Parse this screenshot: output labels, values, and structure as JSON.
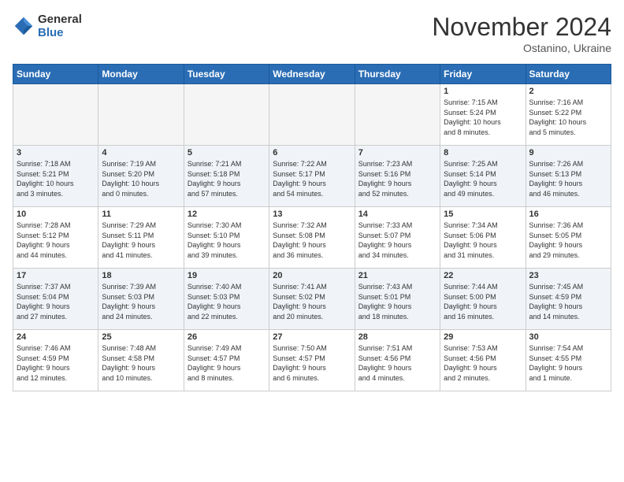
{
  "logo": {
    "line1": "General",
    "line2": "Blue"
  },
  "title": "November 2024",
  "location": "Ostanino, Ukraine",
  "days_of_week": [
    "Sunday",
    "Monday",
    "Tuesday",
    "Wednesday",
    "Thursday",
    "Friday",
    "Saturday"
  ],
  "weeks": [
    [
      {
        "day": "",
        "info": ""
      },
      {
        "day": "",
        "info": ""
      },
      {
        "day": "",
        "info": ""
      },
      {
        "day": "",
        "info": ""
      },
      {
        "day": "",
        "info": ""
      },
      {
        "day": "1",
        "info": "Sunrise: 7:15 AM\nSunset: 5:24 PM\nDaylight: 10 hours\nand 8 minutes."
      },
      {
        "day": "2",
        "info": "Sunrise: 7:16 AM\nSunset: 5:22 PM\nDaylight: 10 hours\nand 5 minutes."
      }
    ],
    [
      {
        "day": "3",
        "info": "Sunrise: 7:18 AM\nSunset: 5:21 PM\nDaylight: 10 hours\nand 3 minutes."
      },
      {
        "day": "4",
        "info": "Sunrise: 7:19 AM\nSunset: 5:20 PM\nDaylight: 10 hours\nand 0 minutes."
      },
      {
        "day": "5",
        "info": "Sunrise: 7:21 AM\nSunset: 5:18 PM\nDaylight: 9 hours\nand 57 minutes."
      },
      {
        "day": "6",
        "info": "Sunrise: 7:22 AM\nSunset: 5:17 PM\nDaylight: 9 hours\nand 54 minutes."
      },
      {
        "day": "7",
        "info": "Sunrise: 7:23 AM\nSunset: 5:16 PM\nDaylight: 9 hours\nand 52 minutes."
      },
      {
        "day": "8",
        "info": "Sunrise: 7:25 AM\nSunset: 5:14 PM\nDaylight: 9 hours\nand 49 minutes."
      },
      {
        "day": "9",
        "info": "Sunrise: 7:26 AM\nSunset: 5:13 PM\nDaylight: 9 hours\nand 46 minutes."
      }
    ],
    [
      {
        "day": "10",
        "info": "Sunrise: 7:28 AM\nSunset: 5:12 PM\nDaylight: 9 hours\nand 44 minutes."
      },
      {
        "day": "11",
        "info": "Sunrise: 7:29 AM\nSunset: 5:11 PM\nDaylight: 9 hours\nand 41 minutes."
      },
      {
        "day": "12",
        "info": "Sunrise: 7:30 AM\nSunset: 5:10 PM\nDaylight: 9 hours\nand 39 minutes."
      },
      {
        "day": "13",
        "info": "Sunrise: 7:32 AM\nSunset: 5:08 PM\nDaylight: 9 hours\nand 36 minutes."
      },
      {
        "day": "14",
        "info": "Sunrise: 7:33 AM\nSunset: 5:07 PM\nDaylight: 9 hours\nand 34 minutes."
      },
      {
        "day": "15",
        "info": "Sunrise: 7:34 AM\nSunset: 5:06 PM\nDaylight: 9 hours\nand 31 minutes."
      },
      {
        "day": "16",
        "info": "Sunrise: 7:36 AM\nSunset: 5:05 PM\nDaylight: 9 hours\nand 29 minutes."
      }
    ],
    [
      {
        "day": "17",
        "info": "Sunrise: 7:37 AM\nSunset: 5:04 PM\nDaylight: 9 hours\nand 27 minutes."
      },
      {
        "day": "18",
        "info": "Sunrise: 7:39 AM\nSunset: 5:03 PM\nDaylight: 9 hours\nand 24 minutes."
      },
      {
        "day": "19",
        "info": "Sunrise: 7:40 AM\nSunset: 5:03 PM\nDaylight: 9 hours\nand 22 minutes."
      },
      {
        "day": "20",
        "info": "Sunrise: 7:41 AM\nSunset: 5:02 PM\nDaylight: 9 hours\nand 20 minutes."
      },
      {
        "day": "21",
        "info": "Sunrise: 7:43 AM\nSunset: 5:01 PM\nDaylight: 9 hours\nand 18 minutes."
      },
      {
        "day": "22",
        "info": "Sunrise: 7:44 AM\nSunset: 5:00 PM\nDaylight: 9 hours\nand 16 minutes."
      },
      {
        "day": "23",
        "info": "Sunrise: 7:45 AM\nSunset: 4:59 PM\nDaylight: 9 hours\nand 14 minutes."
      }
    ],
    [
      {
        "day": "24",
        "info": "Sunrise: 7:46 AM\nSunset: 4:59 PM\nDaylight: 9 hours\nand 12 minutes."
      },
      {
        "day": "25",
        "info": "Sunrise: 7:48 AM\nSunset: 4:58 PM\nDaylight: 9 hours\nand 10 minutes."
      },
      {
        "day": "26",
        "info": "Sunrise: 7:49 AM\nSunset: 4:57 PM\nDaylight: 9 hours\nand 8 minutes."
      },
      {
        "day": "27",
        "info": "Sunrise: 7:50 AM\nSunset: 4:57 PM\nDaylight: 9 hours\nand 6 minutes."
      },
      {
        "day": "28",
        "info": "Sunrise: 7:51 AM\nSunset: 4:56 PM\nDaylight: 9 hours\nand 4 minutes."
      },
      {
        "day": "29",
        "info": "Sunrise: 7:53 AM\nSunset: 4:56 PM\nDaylight: 9 hours\nand 2 minutes."
      },
      {
        "day": "30",
        "info": "Sunrise: 7:54 AM\nSunset: 4:55 PM\nDaylight: 9 hours\nand 1 minute."
      }
    ]
  ]
}
